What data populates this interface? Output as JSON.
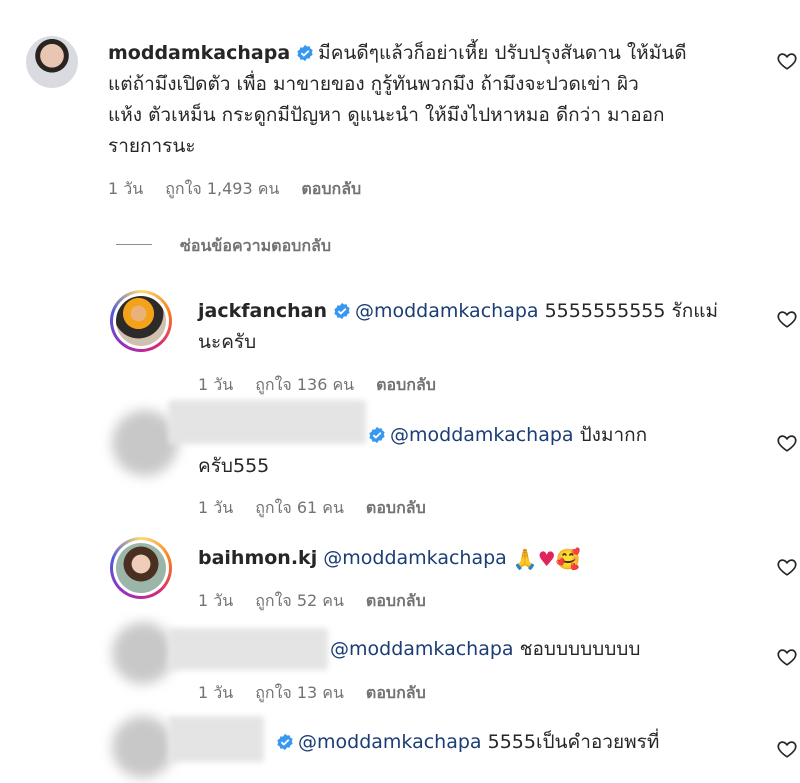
{
  "comments": [
    {
      "username": "moddamkachapa",
      "verified": true,
      "text_lines": [
        "มีคนดีๆแล้วก็อย่าเหี้ย ปรับปรุงสันดาน ให้มันดี",
        "แต่ถ้ามึงเปิดตัว เพื่อ มาขายของ กูรู้ทันพวกมึง ถ้ามึงจะปวดเข่า ผิว",
        "แห้ง ตัวเหม็น กระดูกมีปัญหา ดูแนะนำ ให้มึงไปหาหมอ ดีกว่า มาออก",
        "รายการนะ"
      ],
      "time": "1 วัน",
      "likes": "ถูกใจ 1,493 คน",
      "reply": "ตอบกลับ"
    }
  ],
  "hide_replies": "ซ่อนข้อความตอบกลับ",
  "replies": [
    {
      "username": "jackfanchan",
      "mention": "@moddamkachapa",
      "line1": "5555555555 รักแม่",
      "line2": "นะครับ",
      "time": "1 วัน",
      "likes": "ถูกใจ 136 คน",
      "reply": "ตอบกลับ"
    },
    {
      "mention": "@moddamkachapa",
      "line1": "ปังมากก",
      "line2": "ครับ555",
      "time": "1 วัน",
      "likes": "ถูกใจ 61 คน",
      "reply": "ตอบกลับ"
    },
    {
      "username": "baihmon.kj",
      "mention": "@moddamkachapa",
      "time": "1 วัน",
      "likes": "ถูกใจ 52 คน",
      "reply": "ตอบกลับ"
    },
    {
      "mention": "@moddamkachapa",
      "line1": "ชอบบบบบบบบ",
      "time": "1 วัน",
      "likes": "ถูกใจ 13 คน",
      "reply": "ตอบกลับ"
    },
    {
      "mention": "@moddamkachapa",
      "line1": "5555เป็นคำอวยพรที่"
    }
  ],
  "colors": {
    "mention": "#1b3d75",
    "verified": "#3897f0",
    "meta": "#737373"
  },
  "icons": [
    "heart-icon",
    "verified-badge-icon",
    "folded-hands-emoji",
    "red-heart-emoji",
    "smiling-face-with-hearts-emoji"
  ]
}
